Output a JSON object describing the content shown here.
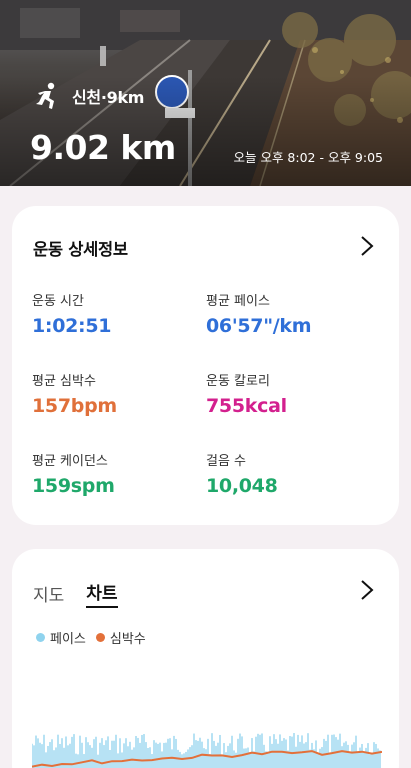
{
  "hero": {
    "title": "신천·9km",
    "distance": "9.02 km",
    "time_range": "오늘 오후 8:02 - 오후 9:05"
  },
  "details": {
    "title": "운동 상세정보",
    "stats": [
      {
        "label": "운동 시간",
        "value": "1:02:51",
        "unit": "",
        "color": "#2f6fd8"
      },
      {
        "label": "평균 페이스",
        "value": "06'57\"",
        "unit": "/km",
        "color": "#2f6fd8"
      },
      {
        "label": "평균 심박수",
        "value": "157",
        "unit": "bpm",
        "color": "#e0703a"
      },
      {
        "label": "운동 칼로리",
        "value": "755",
        "unit": "kcal",
        "color": "#d3208e"
      },
      {
        "label": "평균 케이던스",
        "value": "159",
        "unit": "spm",
        "color": "#1fa86a"
      },
      {
        "label": "걸음 수",
        "value": "10,048",
        "unit": "",
        "color": "#1fa86a"
      }
    ]
  },
  "chart_section": {
    "tabs": [
      "지도",
      "차트"
    ],
    "active_tab": "차트",
    "legend": [
      {
        "label": "페이스",
        "color": "#8fd3ee"
      },
      {
        "label": "심박수",
        "color": "#e3703a"
      }
    ]
  },
  "colors": {
    "accent_blue": "#2f6fd8",
    "heart_orange": "#e0703a",
    "calorie_pink": "#d3208e",
    "cadence_green": "#1fa86a"
  },
  "icons": {
    "activity": "running-person-icon",
    "more": "chevron-right-icon"
  }
}
